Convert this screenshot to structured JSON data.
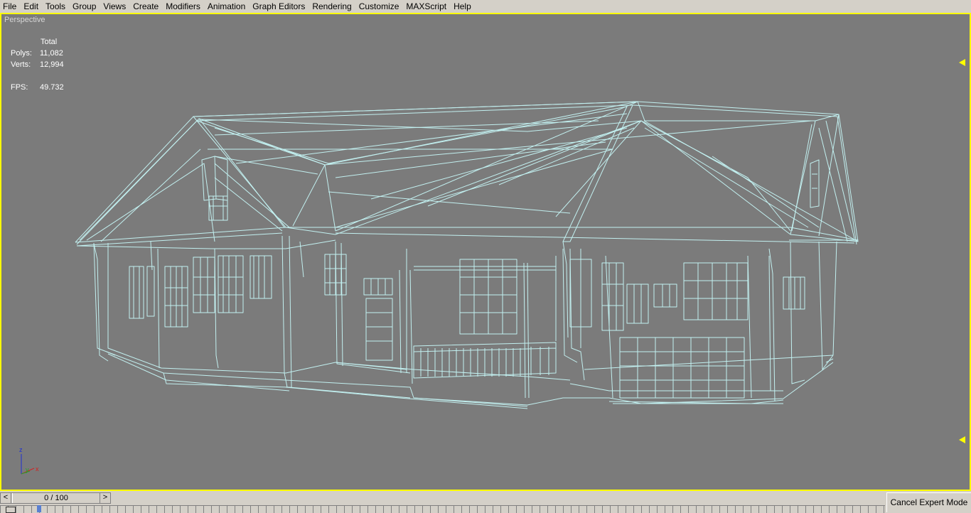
{
  "menu": [
    "File",
    "Edit",
    "Tools",
    "Group",
    "Views",
    "Create",
    "Modifiers",
    "Animation",
    "Graph Editors",
    "Rendering",
    "Customize",
    "MAXScript",
    "Help"
  ],
  "viewport": {
    "label": "Perspective",
    "stats": {
      "header": "Total",
      "polys_label": "Polys:",
      "polys_value": "11,082",
      "verts_label": "Verts:",
      "verts_value": "12,994",
      "fps_label": "FPS:",
      "fps_value": "49.732"
    },
    "axes": {
      "x": "x",
      "y": "y",
      "z": "z"
    },
    "wire_color": "#c2f0f0",
    "background_color": "#7b7b7b",
    "active_border_color": "#ffff00"
  },
  "time_slider": {
    "label": "0 / 100",
    "prev_glyph": "<",
    "next_glyph": ">",
    "current_frame": 0,
    "total_frames": 100
  },
  "expert_mode": {
    "label": "Cancel Expert Mode"
  }
}
